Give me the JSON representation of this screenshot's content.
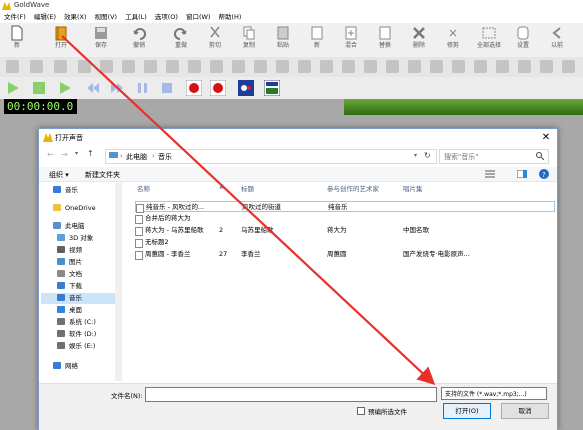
{
  "app": {
    "title": "GoldWave"
  },
  "menu": [
    "文件(F)",
    "编辑(E)",
    "效果(X)",
    "视图(V)",
    "工具(L)",
    "选项(O)",
    "窗口(W)",
    "帮助(H)"
  ],
  "toolbar": [
    {
      "label": "新",
      "icon": "new-file-icon"
    },
    {
      "label": "打开",
      "icon": "open-file-icon"
    },
    {
      "label": "保存",
      "icon": "save-icon"
    },
    {
      "label": "撤销",
      "icon": "undo-icon"
    },
    {
      "label": "重做",
      "icon": "redo-icon"
    },
    {
      "label": "剪切",
      "icon": "cut-icon"
    },
    {
      "label": "复制",
      "icon": "copy-icon"
    },
    {
      "label": "粘贴",
      "icon": "paste-icon"
    },
    {
      "label": "新",
      "icon": "paste-new-icon"
    },
    {
      "label": "混合",
      "icon": "mix-icon"
    },
    {
      "label": "替换",
      "icon": "replace-icon"
    },
    {
      "label": "删除",
      "icon": "delete-icon"
    },
    {
      "label": "修剪",
      "icon": "trim-icon"
    },
    {
      "label": "全部选择",
      "icon": "select-all-icon"
    },
    {
      "label": "设置",
      "icon": "set-icon"
    },
    {
      "label": "以前",
      "icon": "previous-icon"
    }
  ],
  "time_display": "00:00:00.0",
  "dialog": {
    "title": "打开声音",
    "breadcrumb": [
      "此电脑",
      "音乐"
    ],
    "search_placeholder": "搜索\"音乐\"",
    "commands": {
      "organize": "组织 ▾",
      "new_folder": "新建文件夹"
    },
    "nav": [
      {
        "label": "音乐",
        "icon": "music-icon",
        "color": "#3a7bd5"
      },
      {
        "label": "OneDrive",
        "icon": "onedrive-icon",
        "color": "#f0c040"
      },
      {
        "label": "此电脑",
        "icon": "computer-icon",
        "color": "#5a8fd0"
      },
      {
        "label": "3D 对象",
        "icon": "3d-objects-icon",
        "color": "#5aa0e0"
      },
      {
        "label": "视频",
        "icon": "video-icon",
        "color": "#606060"
      },
      {
        "label": "图片",
        "icon": "pictures-icon",
        "color": "#4a90c8"
      },
      {
        "label": "文档",
        "icon": "documents-icon",
        "color": "#8a8a8a"
      },
      {
        "label": "下载",
        "icon": "downloads-icon",
        "color": "#3a7bd5"
      },
      {
        "label": "音乐",
        "icon": "music-icon",
        "color": "#3a7bd5"
      },
      {
        "label": "桌面",
        "icon": "desktop-icon",
        "color": "#2d86d6"
      },
      {
        "label": "系统 (C:)",
        "icon": "drive-icon",
        "color": "#707070"
      },
      {
        "label": "软件 (D:)",
        "icon": "drive-icon",
        "color": "#707070"
      },
      {
        "label": "娱乐 (E:)",
        "icon": "drive-icon",
        "color": "#707070"
      },
      {
        "label": "网络",
        "icon": "network-icon",
        "color": "#3a7bd5"
      }
    ],
    "columns": [
      "名称",
      "#",
      "标题",
      "参与创作的艺术家",
      "唱片集"
    ],
    "files": [
      {
        "name": "纯音乐 - 风吹过的...",
        "num": "",
        "title": "风吹过的街道",
        "artist": "纯音乐",
        "album": ""
      },
      {
        "name": "合并后的蒋大为",
        "num": "",
        "title": "",
        "artist": "",
        "album": ""
      },
      {
        "name": "蒋大为 - 乌苏里船歌",
        "num": "2",
        "title": "乌苏里船歌",
        "artist": "蒋大为",
        "album": "中国名歌"
      },
      {
        "name": "无标题2",
        "num": "",
        "title": "",
        "artist": "",
        "album": ""
      },
      {
        "name": "周蕙圆 - 李香兰",
        "num": "27",
        "title": "李香兰",
        "artist": "周蕙圆",
        "album": "国产发烧专·电影原声..."
      }
    ],
    "filename_label": "文件名(N):",
    "filename_value": "",
    "filetype_value": "支持的文件 (*.wav;*.mp3;...)",
    "preview_label": "预编所选文件",
    "open_label": "打开(O)",
    "cancel_label": "取消"
  }
}
